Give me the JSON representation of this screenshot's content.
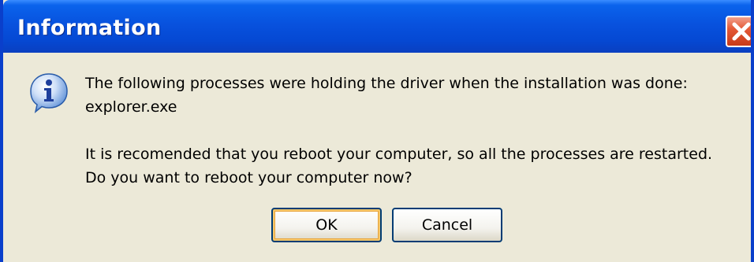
{
  "window": {
    "title": "Information",
    "close_icon": "close-icon"
  },
  "message": {
    "icon": "info-icon",
    "line1": "The following processes were holding the driver when the installation was done:",
    "line2": "explorer.exe",
    "line3": "It is recomended that you reboot your computer, so all the processes are restarted.",
    "line4": "Do you want to reboot your computer now?"
  },
  "buttons": {
    "ok_label": "OK",
    "cancel_label": "Cancel"
  },
  "colors": {
    "titlebar": "#0852de",
    "close_button": "#e45a38",
    "dialog_background": "#ece9d8",
    "default_button_highlight": "#f4c76b"
  }
}
